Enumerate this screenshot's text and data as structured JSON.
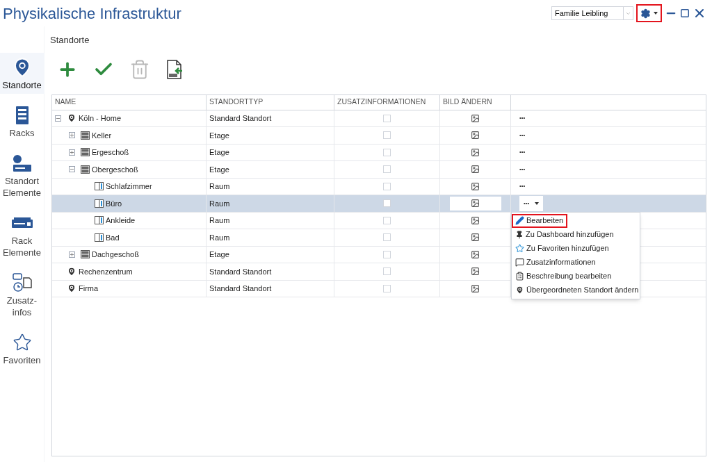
{
  "window": {
    "title": "Physikalische Infrastruktur"
  },
  "header": {
    "profile": {
      "value": "Familie Leibling"
    },
    "settings_highlighted": true
  },
  "sidebar": {
    "items": [
      {
        "label": "Standorte",
        "selected": true
      },
      {
        "label": "Racks",
        "selected": false
      },
      {
        "label": "Standort Elemente",
        "selected": false
      },
      {
        "label": "Rack Elemente",
        "selected": false
      },
      {
        "label": "Zusatz-infos",
        "selected": false
      },
      {
        "label": "Favoriten",
        "selected": false
      }
    ]
  },
  "panel": {
    "title": "Standorte",
    "toolbar": [
      {
        "kind": "add",
        "disabled": false
      },
      {
        "kind": "confirm",
        "disabled": false
      },
      {
        "kind": "delete",
        "disabled": true
      },
      {
        "kind": "csv",
        "disabled": false
      }
    ]
  },
  "table": {
    "columns": [
      "NAME",
      "STANDORTTYP",
      "ZUSATZINFORMATIONEN",
      "BILD ÄNDERN"
    ],
    "rows": [
      {
        "name": "Köln - Home",
        "type": "Standard Standort",
        "kind": "site",
        "expanded": true,
        "checked": false,
        "selected": false,
        "actions": "•••",
        "children": [
          {
            "name": "Keller",
            "type": "Etage",
            "kind": "floor",
            "expanded": false,
            "checked": false,
            "selected": false,
            "actions": "•••"
          },
          {
            "name": "Ergeschoß",
            "type": "Etage",
            "kind": "floor",
            "expanded": false,
            "checked": false,
            "selected": false,
            "actions": "•••"
          },
          {
            "name": "Obergeschoß",
            "type": "Etage",
            "kind": "floor",
            "expanded": true,
            "checked": false,
            "selected": false,
            "actions": "•••",
            "children": [
              {
                "name": "Schlafzimmer",
                "type": "Raum",
                "kind": "room",
                "checked": false,
                "selected": false,
                "actions": "•••"
              },
              {
                "name": "Büro",
                "type": "Raum",
                "kind": "room",
                "checked": false,
                "selected": true,
                "actions": "•••"
              },
              {
                "name": "Ankleide",
                "type": "Raum",
                "kind": "room",
                "checked": false,
                "selected": false
              },
              {
                "name": "Bad",
                "type": "Raum",
                "kind": "room",
                "checked": false,
                "selected": false
              }
            ]
          },
          {
            "name": "Dachgeschoß",
            "type": "Etage",
            "kind": "floor",
            "expanded": false,
            "checked": false,
            "selected": false
          }
        ]
      },
      {
        "name": "Rechenzentrum",
        "type": "Standard Standort",
        "kind": "site",
        "checked": false,
        "selected": false
      },
      {
        "name": "Firma",
        "type": "Standard Standort",
        "kind": "site",
        "checked": false,
        "selected": false
      }
    ]
  },
  "context_menu": {
    "items": [
      {
        "label": "Bearbeiten",
        "highlighted": true
      },
      {
        "label": "Zu Dashboard hinzufügen",
        "highlighted": false
      },
      {
        "label": "Zu Favoriten hinzufügen",
        "highlighted": false
      },
      {
        "label": "Zusatzinformationen",
        "highlighted": false
      },
      {
        "label": "Beschreibung bearbeiten",
        "highlighted": false
      },
      {
        "label": "Übergeordneten Standort ändern",
        "highlighted": false
      }
    ]
  }
}
